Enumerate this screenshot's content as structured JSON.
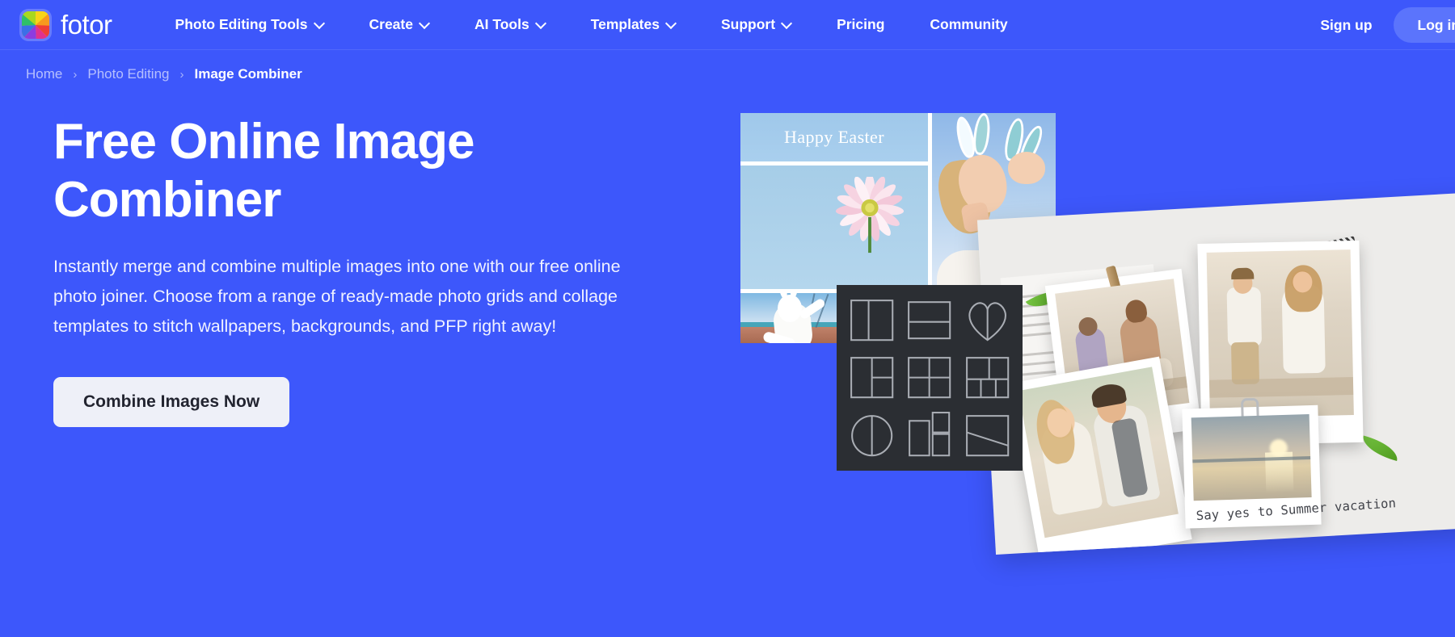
{
  "theme": {
    "brand_blue": "#3d57fb",
    "login_pill": "#5b74fc",
    "cta_bg": "#eef0f8",
    "cta_text": "#222430",
    "panel_dark": "#2b2e33"
  },
  "header": {
    "brand_name": "fotor",
    "logo_icon": "fotor-color-wheel-icon",
    "nav": [
      {
        "label": "Photo Editing Tools",
        "has_dropdown": true,
        "icon": "chevron-down-icon"
      },
      {
        "label": "Create",
        "has_dropdown": true,
        "icon": "chevron-down-icon"
      },
      {
        "label": "AI Tools",
        "has_dropdown": true,
        "icon": "chevron-down-icon"
      },
      {
        "label": "Templates",
        "has_dropdown": true,
        "icon": "chevron-down-icon"
      },
      {
        "label": "Support",
        "has_dropdown": true,
        "icon": "chevron-down-icon"
      },
      {
        "label": "Pricing",
        "has_dropdown": false
      },
      {
        "label": "Community",
        "has_dropdown": false
      }
    ],
    "sign_up_label": "Sign up",
    "log_in_label": "Log in"
  },
  "breadcrumb": {
    "separator": "›",
    "items": [
      {
        "label": "Home",
        "current": false
      },
      {
        "label": "Photo Editing",
        "current": false
      },
      {
        "label": "Image Combiner",
        "current": true
      }
    ]
  },
  "hero": {
    "title": "Free Online Image Combiner",
    "description": "Instantly merge and combine multiple images into one with our free online photo joiner. Choose from a range of ready-made photo grids and collage templates to stitch wallpapers, backgrounds, and PFP right away!",
    "cta_label": "Combine Images Now"
  },
  "artwork": {
    "collage": {
      "overlay_text": "Happy Easter",
      "cells": [
        {
          "name": "easter-greeting-tile",
          "caption": "Happy Easter"
        },
        {
          "name": "pink-gerbera-flower-tile",
          "caption": ""
        },
        {
          "name": "woman-bunny-ears-tile",
          "caption": ""
        },
        {
          "name": "bunny-costume-tile",
          "caption": ""
        },
        {
          "name": "sky-clouds-tile",
          "caption": ""
        }
      ]
    },
    "template_panel": {
      "name": "collage-layout-template-picker",
      "templates": [
        {
          "id": "two-vertical-panels",
          "icon": "grid-2-columns-icon"
        },
        {
          "id": "two-horizontal-panels",
          "icon": "grid-2-rows-icon"
        },
        {
          "id": "heart-split",
          "icon": "heart-shape-icon"
        },
        {
          "id": "left-tall-right-split",
          "icon": "grid-1-plus-2-icon"
        },
        {
          "id": "two-by-two",
          "icon": "grid-2x2-icon"
        },
        {
          "id": "two-top-three-bottom",
          "icon": "grid-2-plus-3-icon"
        },
        {
          "id": "circle-split",
          "icon": "circle-shape-icon"
        },
        {
          "id": "tall-plus-two-stacked",
          "icon": "grid-tall-stack-icon"
        },
        {
          "id": "diagonal-split",
          "icon": "diagonal-split-icon"
        }
      ]
    },
    "board": {
      "caption": "Say yes to Summer vacation",
      "photos": [
        {
          "name": "couple-sitting-beach-polaroid"
        },
        {
          "name": "couple-walking-beach-polaroid"
        },
        {
          "name": "wedding-couple-polaroid"
        },
        {
          "name": "sunset-beach-polaroid"
        }
      ]
    }
  }
}
